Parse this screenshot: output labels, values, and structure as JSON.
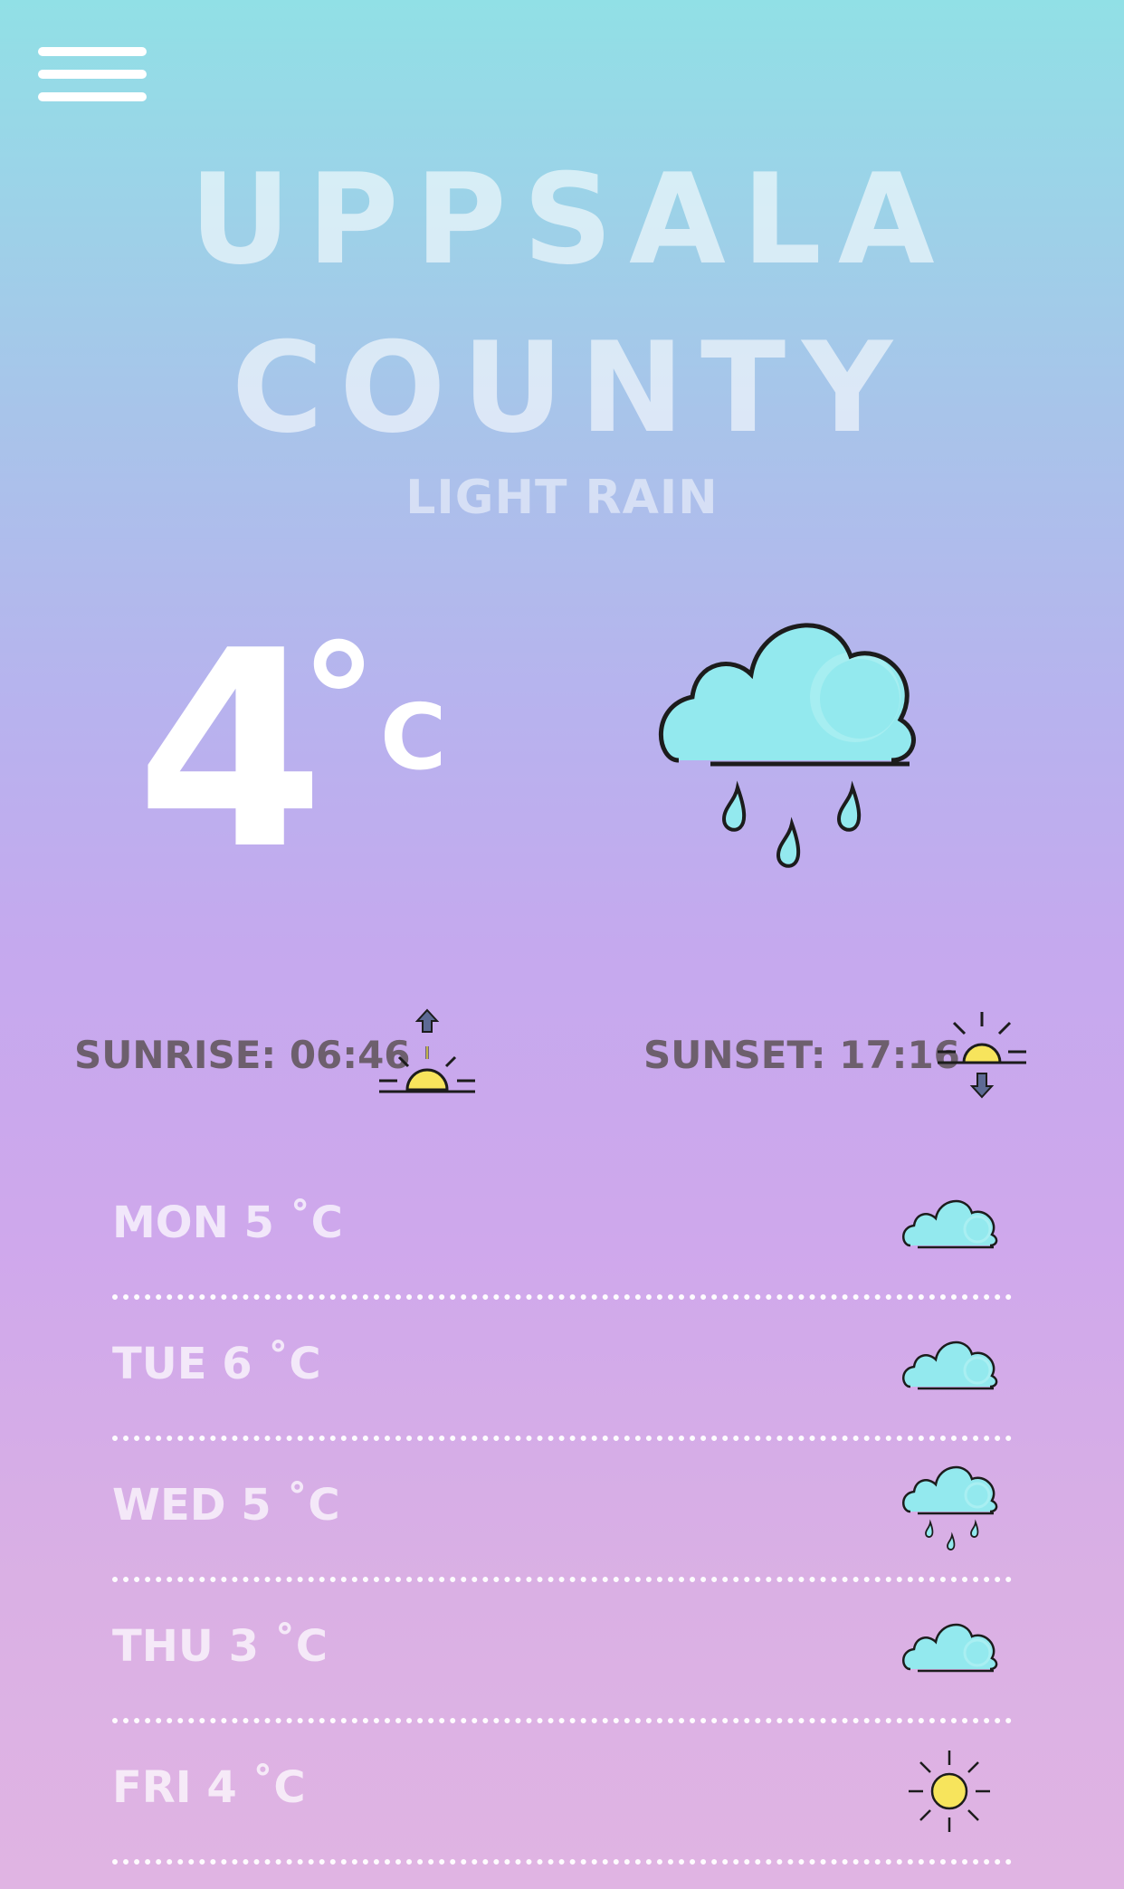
{
  "header": {
    "menu_icon": "hamburger-menu-icon"
  },
  "location": {
    "line1": "UPPSALA",
    "line2": "COUNTY"
  },
  "current": {
    "condition": "LIGHT RAIN",
    "temperature": "4",
    "degree_symbol": "°",
    "unit": "C",
    "icon": "cloud-rain-icon"
  },
  "sun": {
    "sunrise_label": "SUNRISE: 06:46",
    "sunrise_icon": "sunrise-icon",
    "sunset_label": "SUNSET: 17:16",
    "sunset_icon": "sunset-icon"
  },
  "forecast": [
    {
      "label": "MON 5 ˚C",
      "icon": "cloud-icon"
    },
    {
      "label": "TUE 6 ˚C",
      "icon": "cloud-icon"
    },
    {
      "label": "WED 5 ˚C",
      "icon": "cloud-rain-icon"
    },
    {
      "label": "THU 3 ˚C",
      "icon": "cloud-icon"
    },
    {
      "label": "FRI 4 ˚C",
      "icon": "sun-icon"
    }
  ],
  "colors": {
    "cloud": "#93e9ee",
    "sun": "#f7e45c",
    "outline": "#1c1c1c",
    "arrow": "#5d6a95",
    "text_dark": "#6d5f6d"
  }
}
